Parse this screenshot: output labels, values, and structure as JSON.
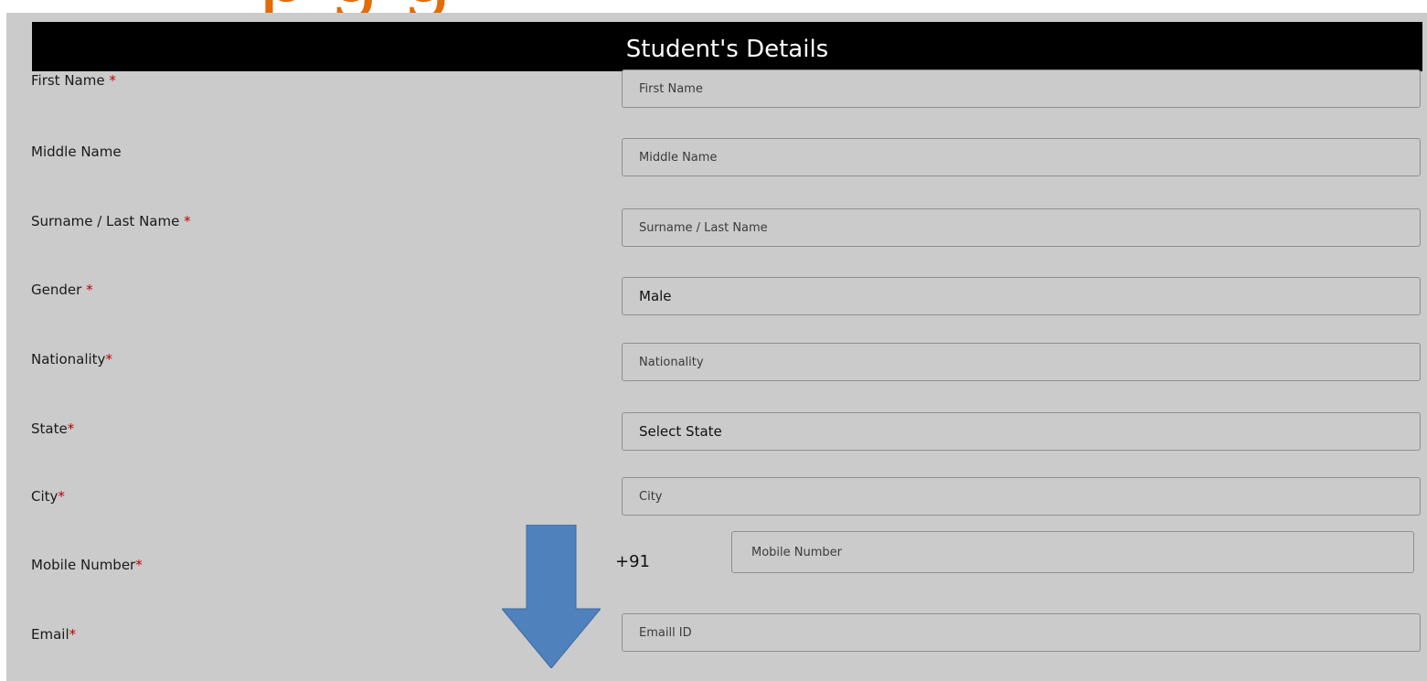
{
  "header": {
    "title": "Student's Details"
  },
  "fields": {
    "first_name": {
      "label": "First Name",
      "placeholder": "First Name"
    },
    "middle_name": {
      "label": "Middle Name",
      "placeholder": "Middle Name"
    },
    "surname": {
      "label": "Surname / Last Name",
      "placeholder": "Surname / Last Name"
    },
    "gender": {
      "label": "Gender",
      "value": "Male"
    },
    "nationality": {
      "label": "Nationality",
      "placeholder": "Nationality"
    },
    "state": {
      "label": "State",
      "value": "Select State"
    },
    "city": {
      "label": "City",
      "placeholder": "City"
    },
    "mobile": {
      "label": "Mobile Number",
      "prefix": "+91",
      "placeholder": "Mobile Number"
    },
    "email": {
      "label": "Email",
      "placeholder": "Emaill ID"
    }
  },
  "required_marker": "*",
  "icons": {
    "arrow": "arrow-down-icon"
  },
  "colors": {
    "panel_bg": "#cbcbcb",
    "header_bg": "#000000",
    "required": "#c00000",
    "arrow": "#4f81bd"
  }
}
